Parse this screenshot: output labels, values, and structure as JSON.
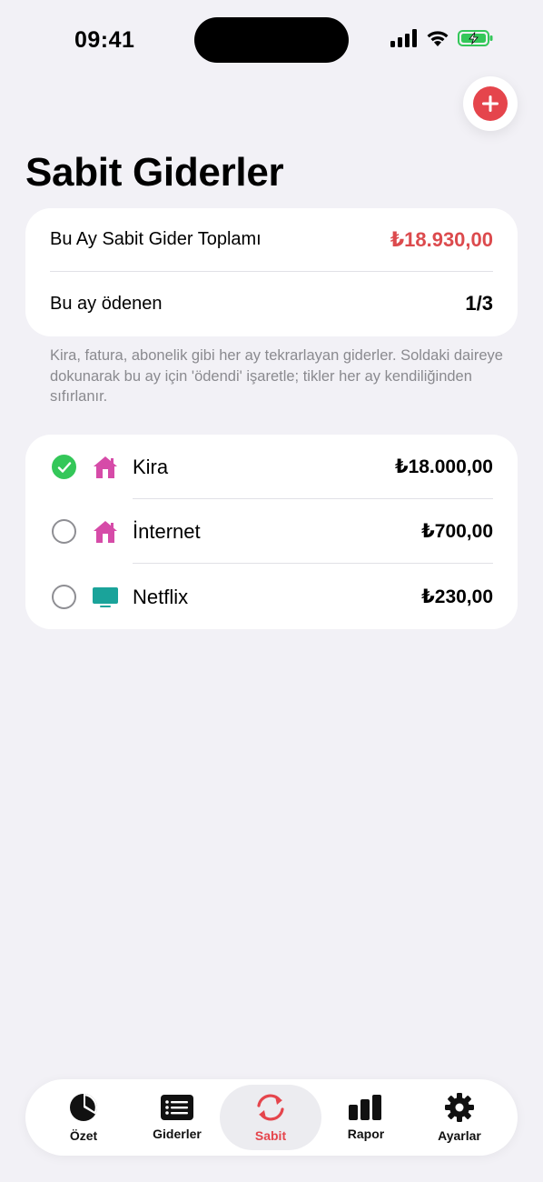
{
  "status_bar": {
    "time": "09:41"
  },
  "header": {
    "title": "Sabit Giderler",
    "add_icon": "plus-circle-icon"
  },
  "summary": {
    "total_label": "Bu Ay Sabit Gider Toplamı",
    "total_value": "₺18.930,00",
    "paid_label": "Bu ay ödenen",
    "paid_value": "1/3"
  },
  "hint": "Kira, fatura, abonelik gibi her ay tekrarlayan giderler. Soldaki daireye dokunarak bu ay için 'ödendi' işaretle; tikler her ay kendiliğinden sıfırlanır.",
  "expenses": [
    {
      "name": "Kira",
      "amount": "₺18.000,00",
      "paid": true,
      "icon": "house-icon"
    },
    {
      "name": "İnternet",
      "amount": "₺700,00",
      "paid": false,
      "icon": "house-icon"
    },
    {
      "name": "Netflix",
      "amount": "₺230,00",
      "paid": false,
      "icon": "tv-icon"
    }
  ],
  "tabs": [
    {
      "label": "Özet",
      "icon": "pie-chart-icon",
      "active": false
    },
    {
      "label": "Giderler",
      "icon": "list-icon",
      "active": false
    },
    {
      "label": "Sabit",
      "icon": "recurring-icon",
      "active": true
    },
    {
      "label": "Rapor",
      "icon": "bar-chart-icon",
      "active": false
    },
    {
      "label": "Ayarlar",
      "icon": "gear-icon",
      "active": false
    }
  ],
  "colors": {
    "accent": "#e5454c",
    "paid_green": "#34c759",
    "house_pink": "#d64ba8",
    "tv_teal": "#1aa39a"
  }
}
